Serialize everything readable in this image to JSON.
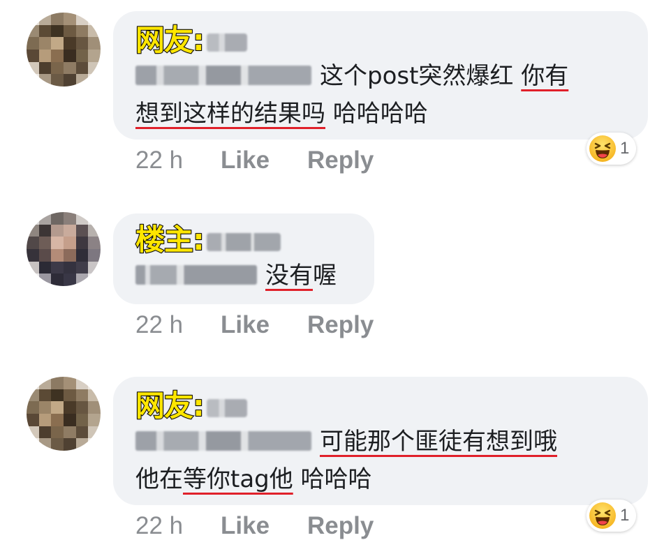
{
  "comments": [
    {
      "role_label": "网友:",
      "text_line1_visible": "这个post突然爆红 ",
      "text_line1_underlined": "你有",
      "text_line2_underlined": "想到这样的结果吗",
      "text_line2_plain": " 哈哈哈哈",
      "time": "22 h",
      "like_label": "Like",
      "reply_label": "Reply",
      "reaction_count": "1",
      "reaction_icon": "laughing-emoji-icon"
    },
    {
      "role_label": "楼主:",
      "text_line1_underlined": "没有",
      "text_line1_plain": "喔",
      "time": "22 h",
      "like_label": "Like",
      "reply_label": "Reply"
    },
    {
      "role_label": "网友:",
      "text_line1_underlined": "可能那个匪徒有想到哦",
      "text_line2_plain_a": "他在",
      "text_line2_underlined": "等你tag他",
      "text_line2_plain_b": " 哈哈哈",
      "time": "22 h",
      "like_label": "Like",
      "reply_label": "Reply",
      "reaction_count": "1",
      "reaction_icon": "laughing-emoji-icon"
    }
  ],
  "colors": {
    "bubble_bg": "#f0f2f5",
    "meta_text": "#8a8d91",
    "role_tag_fill": "#ffe600",
    "underline_red": "#e0202a"
  }
}
